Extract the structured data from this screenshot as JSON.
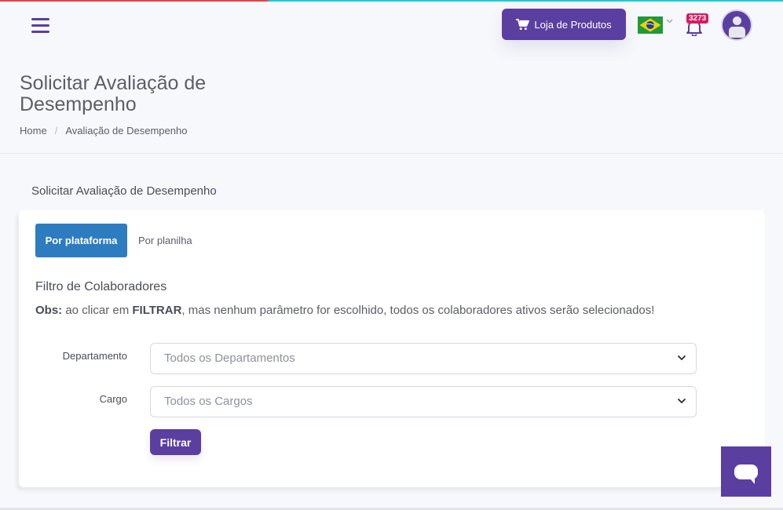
{
  "header": {
    "shop_button_label": "Loja de Produtos",
    "notification_count": "3273",
    "language": "pt-BR"
  },
  "page": {
    "title": "Solicitar Avaliação de Desempenho",
    "breadcrumb": [
      "Home",
      "Avaliação de Desempenho"
    ]
  },
  "section": {
    "title": "Solicitar Avaliação de Desempenho"
  },
  "tabs": [
    {
      "label": "Por plataforma",
      "active": true
    },
    {
      "label": "Por planilha",
      "active": false
    }
  ],
  "filter": {
    "title": "Filtro de Colaboradores",
    "obs_prefix": "Obs:",
    "obs_text_1": " ao clicar em ",
    "obs_keyword": "FILTRAR",
    "obs_text_2": ", mas nenhum parâmetro for escolhido, todos os colaboradores ativos serão selecionados!",
    "department_label": "Departamento",
    "department_value": "Todos os Departamentos",
    "role_label": "Cargo",
    "role_value": "Todos os Cargos",
    "button_label": "Filtrar"
  },
  "colors": {
    "primary": "#5b3fa0",
    "tab_active": "#2e7cc0",
    "badge": "#d81b60"
  },
  "icons": [
    "menu-icon",
    "cart-icon",
    "brazil-flag-icon",
    "chevron-down-icon",
    "bell-icon",
    "user-avatar-icon",
    "chat-icon"
  ]
}
